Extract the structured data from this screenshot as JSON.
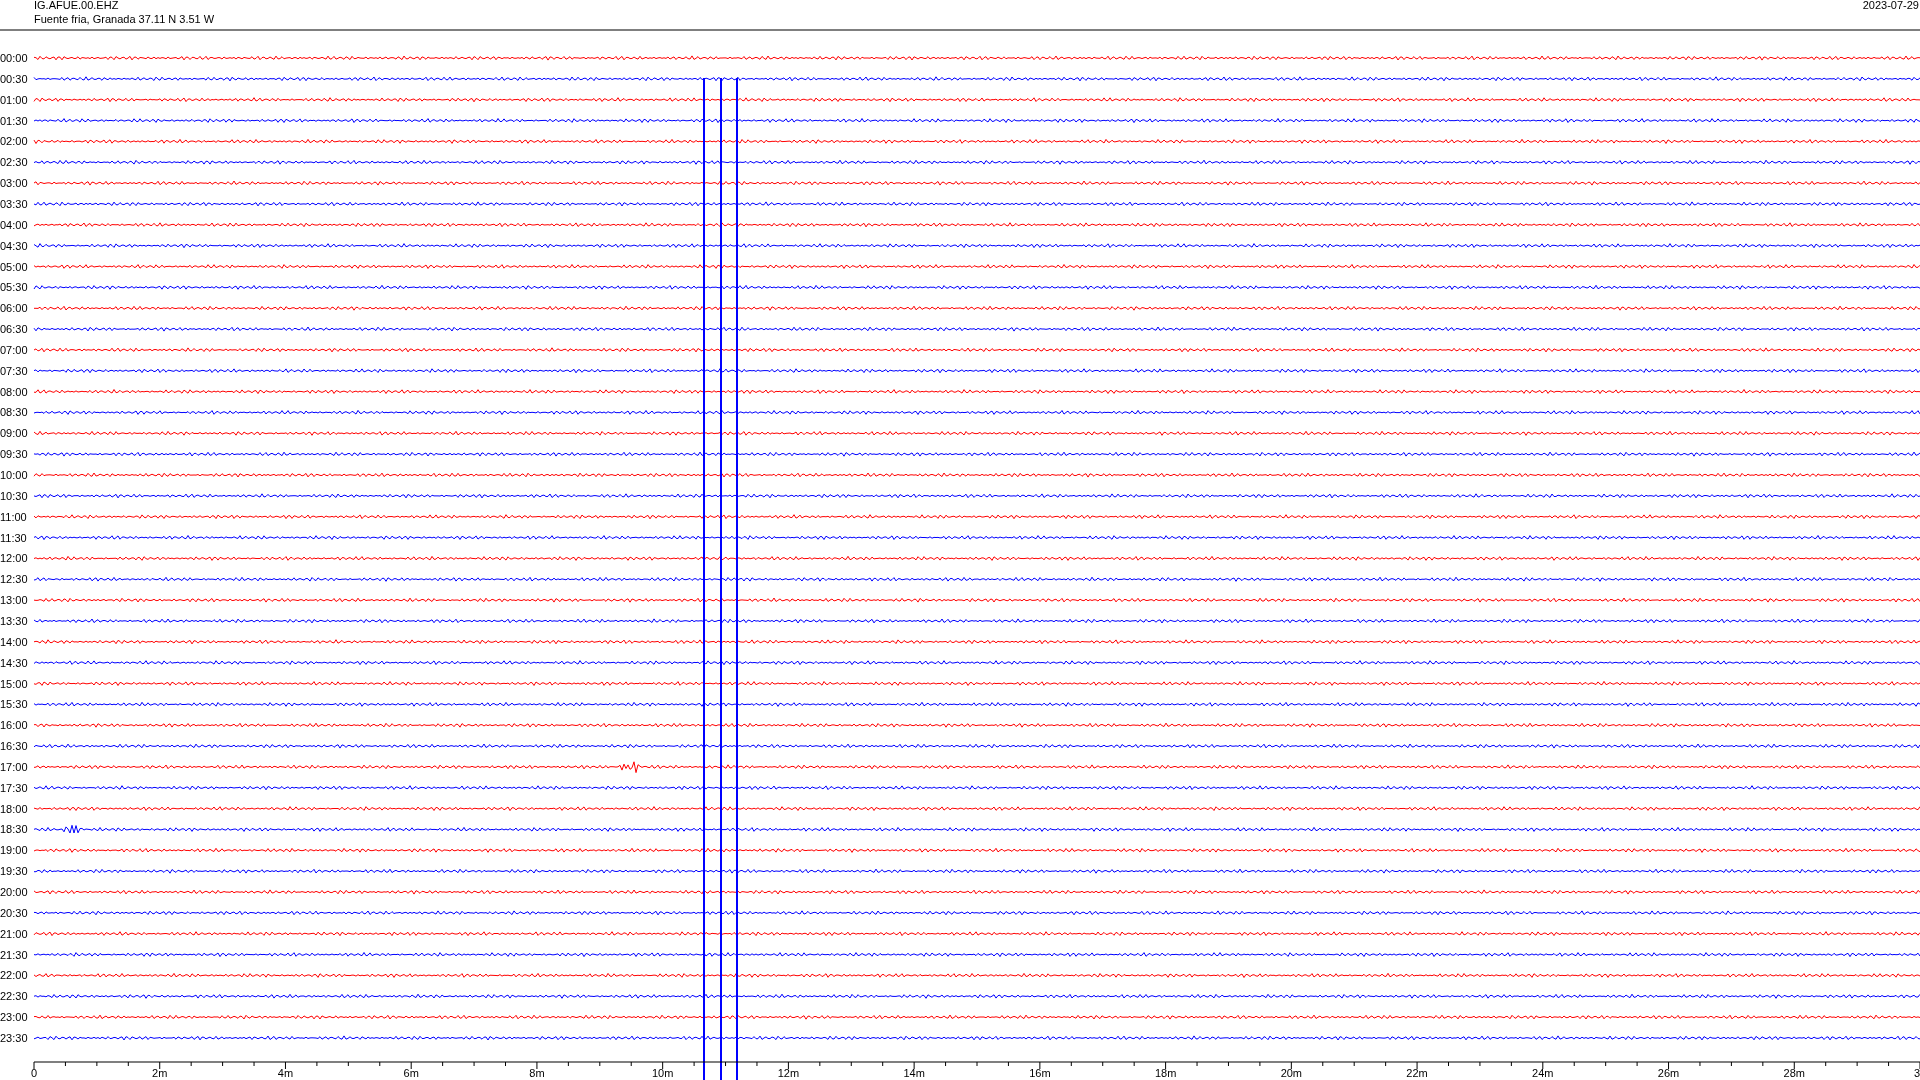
{
  "header": {
    "station": "IG.AFUE.00.EHZ",
    "location": "Fuente fria, Granada  37.11 N 3.51 W",
    "date": "2023-07-29"
  },
  "rows": [
    {
      "time": "00:00",
      "color": "#ff0000"
    },
    {
      "time": "00:30",
      "color": "#0000ff"
    },
    {
      "time": "01:00",
      "color": "#ff0000"
    },
    {
      "time": "01:30",
      "color": "#0000ff"
    },
    {
      "time": "02:00",
      "color": "#ff0000"
    },
    {
      "time": "02:30",
      "color": "#0000ff"
    },
    {
      "time": "03:00",
      "color": "#ff0000"
    },
    {
      "time": "03:30",
      "color": "#0000ff"
    },
    {
      "time": "04:00",
      "color": "#ff0000"
    },
    {
      "time": "04:30",
      "color": "#0000ff"
    },
    {
      "time": "05:00",
      "color": "#ff0000"
    },
    {
      "time": "05:30",
      "color": "#0000ff"
    },
    {
      "time": "06:00",
      "color": "#ff0000"
    },
    {
      "time": "06:30",
      "color": "#0000ff"
    },
    {
      "time": "07:00",
      "color": "#ff0000"
    },
    {
      "time": "07:30",
      "color": "#0000ff"
    },
    {
      "time": "08:00",
      "color": "#ff0000"
    },
    {
      "time": "08:30",
      "color": "#0000ff"
    },
    {
      "time": "09:00",
      "color": "#ff0000"
    },
    {
      "time": "09:30",
      "color": "#0000ff"
    },
    {
      "time": "10:00",
      "color": "#ff0000"
    },
    {
      "time": "10:30",
      "color": "#0000ff"
    },
    {
      "time": "11:00",
      "color": "#ff0000"
    },
    {
      "time": "11:30",
      "color": "#0000ff"
    },
    {
      "time": "12:00",
      "color": "#ff0000"
    },
    {
      "time": "12:30",
      "color": "#0000ff"
    },
    {
      "time": "13:00",
      "color": "#ff0000"
    },
    {
      "time": "13:30",
      "color": "#0000ff"
    },
    {
      "time": "14:00",
      "color": "#ff0000"
    },
    {
      "time": "14:30",
      "color": "#0000ff"
    },
    {
      "time": "15:00",
      "color": "#ff0000"
    },
    {
      "time": "15:30",
      "color": "#0000ff"
    },
    {
      "time": "16:00",
      "color": "#ff0000"
    },
    {
      "time": "16:30",
      "color": "#0000ff"
    },
    {
      "time": "17:00",
      "color": "#ff0000"
    },
    {
      "time": "17:30",
      "color": "#0000ff"
    },
    {
      "time": "18:00",
      "color": "#ff0000"
    },
    {
      "time": "18:30",
      "color": "#0000ff"
    },
    {
      "time": "19:00",
      "color": "#ff0000"
    },
    {
      "time": "19:30",
      "color": "#0000ff"
    },
    {
      "time": "20:00",
      "color": "#ff0000"
    },
    {
      "time": "20:30",
      "color": "#0000ff"
    },
    {
      "time": "21:00",
      "color": "#ff0000"
    },
    {
      "time": "21:30",
      "color": "#0000ff"
    },
    {
      "time": "22:00",
      "color": "#ff0000"
    },
    {
      "time": "22:30",
      "color": "#0000ff"
    },
    {
      "time": "23:00",
      "color": "#ff0000"
    },
    {
      "time": "23:30",
      "color": "#0000ff"
    }
  ],
  "x_axis": {
    "labels": [
      "0",
      "2m",
      "4m",
      "6m",
      "8m",
      "10m",
      "12m",
      "14m",
      "16m",
      "18m",
      "20m",
      "22m",
      "24m",
      "26m",
      "28m",
      "3"
    ]
  }
}
